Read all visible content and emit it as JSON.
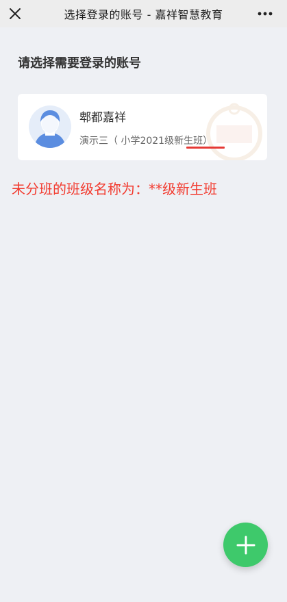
{
  "topbar": {
    "close_icon": "close-icon",
    "title": "选择登录的账号 - 嘉祥智慧教育",
    "more_icon": "more-horizontal-icon"
  },
  "main": {
    "heading": "请选择需要登录的账号",
    "accounts": [
      {
        "name": "郫都嘉祥",
        "detail": "演示三（ 小学2021级新生班）",
        "avatar_icon": "user-avatar-icon"
      }
    ]
  },
  "annotation": {
    "text": "未分班的班级名称为：**级新生班",
    "color": "#f23a2e"
  },
  "fab": {
    "icon": "plus-icon",
    "color": "#3ec96b"
  }
}
